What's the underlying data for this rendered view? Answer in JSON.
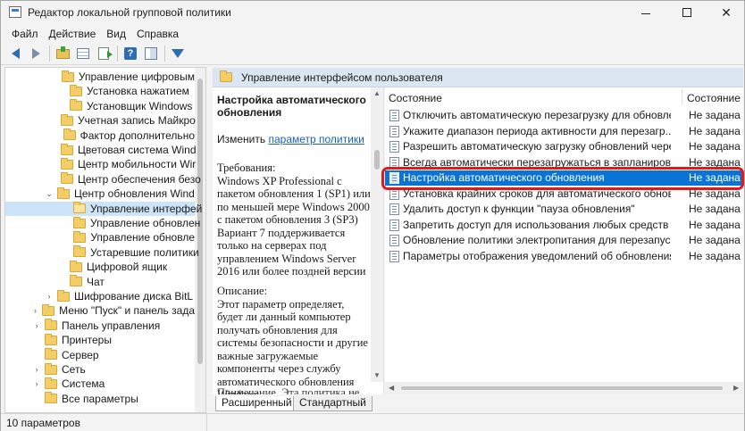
{
  "window": {
    "title": "Редактор локальной групповой политики",
    "controls": {
      "minimize": "—",
      "close": "✕"
    }
  },
  "menu": [
    "Файл",
    "Действие",
    "Вид",
    "Справка"
  ],
  "toolbar": {
    "icons": [
      "back-icon",
      "forward-icon",
      "up-folder-icon",
      "show-hide-tree-icon",
      "export-list-icon",
      "help-icon",
      "properties-icon",
      "filter-icon"
    ],
    "help_glyph": "?"
  },
  "tree": {
    "items": [
      {
        "label": "Управление цифровым",
        "indent": 4,
        "exp": ""
      },
      {
        "label": "Установка нажатием",
        "indent": 4,
        "exp": ""
      },
      {
        "label": "Установщик Windows",
        "indent": 4,
        "exp": ""
      },
      {
        "label": "Учетная запись Майкро",
        "indent": 4,
        "exp": ""
      },
      {
        "label": "Фактор дополнительно",
        "indent": 4,
        "exp": ""
      },
      {
        "label": "Цветовая система Wind",
        "indent": 4,
        "exp": ""
      },
      {
        "label": "Центр мобильности Wir",
        "indent": 4,
        "exp": ""
      },
      {
        "label": "Центр обеспечения безо",
        "indent": 4,
        "exp": ""
      },
      {
        "label": "Центр обновления Wind",
        "indent": 3,
        "exp": "v"
      },
      {
        "label": "Управление интерфей",
        "indent": 5,
        "exp": "",
        "selected": true,
        "open": true
      },
      {
        "label": "Управление обновлен",
        "indent": 5,
        "exp": ""
      },
      {
        "label": "Управление обновле",
        "indent": 5,
        "exp": ""
      },
      {
        "label": "Устаревшие политики",
        "indent": 5,
        "exp": ""
      },
      {
        "label": "Цифровой ящик",
        "indent": 4,
        "exp": ""
      },
      {
        "label": "Чат",
        "indent": 4,
        "exp": ""
      },
      {
        "label": "Шифрование диска BitL",
        "indent": 3,
        "exp": ">"
      },
      {
        "label": "Меню \"Пуск\" и панель зада",
        "indent": 2,
        "exp": ">"
      },
      {
        "label": "Панель управления",
        "indent": 2,
        "exp": ">"
      },
      {
        "label": "Принтеры",
        "indent": 2,
        "exp": ""
      },
      {
        "label": "Сервер",
        "indent": 2,
        "exp": ""
      },
      {
        "label": "Сеть",
        "indent": 2,
        "exp": ">"
      },
      {
        "label": "Система",
        "indent": 2,
        "exp": ">"
      },
      {
        "label": "Все параметры",
        "indent": 2,
        "exp": ""
      }
    ]
  },
  "right_pane": {
    "header": "Управление интерфейсом пользователя",
    "description": {
      "title": "Настройка автоматического обновления",
      "edit_prefix": "Изменить ",
      "edit_link": "параметр политики",
      "requirements": "Требования:\nWindows XP Professional с пакетом обновления 1 (SP1) или по меньшей мере Windows 2000 с пакетом обновления 3 (SP3) Вариант 7 поддерживается только на серверах под управлением Windows Server 2016 или более поздней версии",
      "description_text": "Описание:\nЭтот параметр определяет, будет ли данный компьютер получать обновления для системы безопасности и другие важные загружаемые компоненты через службу автоматического обновления Windows.",
      "more": "Примечание. Эта политика не"
    },
    "list": {
      "col_setting": "Состояние",
      "col_state": "Состояние",
      "rows": [
        {
          "name": "Отключить автоматическую перезагрузку для обновлен...",
          "state": "Не задана"
        },
        {
          "name": "Укажите диапазон периода активности для перезагр...",
          "state": "Не задана"
        },
        {
          "name": "Разрешить автоматическую загрузку обновлений через ...",
          "state": "Не задана"
        },
        {
          "name": "Всегда автоматически перезагружаться в запланирова...",
          "state": "Не задана"
        },
        {
          "name": "Настройка автоматического обновления",
          "state": "Не задана",
          "selected": true
        },
        {
          "name": "Установка крайних сроков для автоматического обнов...",
          "state": "Не задана"
        },
        {
          "name": "Удалить доступ к функции \"пауза обновления\"",
          "state": "Не задана"
        },
        {
          "name": "Запретить доступ для использования любых средств Цен...",
          "state": "Не задана"
        },
        {
          "name": "Обновление политики электропитания для перезапуска ...",
          "state": "Не задана"
        },
        {
          "name": "Параметры отображения уведомлений об обновлениях",
          "state": "Не задана"
        }
      ]
    },
    "tabs": [
      "Расширенный",
      "Стандартный"
    ]
  },
  "status": {
    "text": "10 параметров"
  }
}
